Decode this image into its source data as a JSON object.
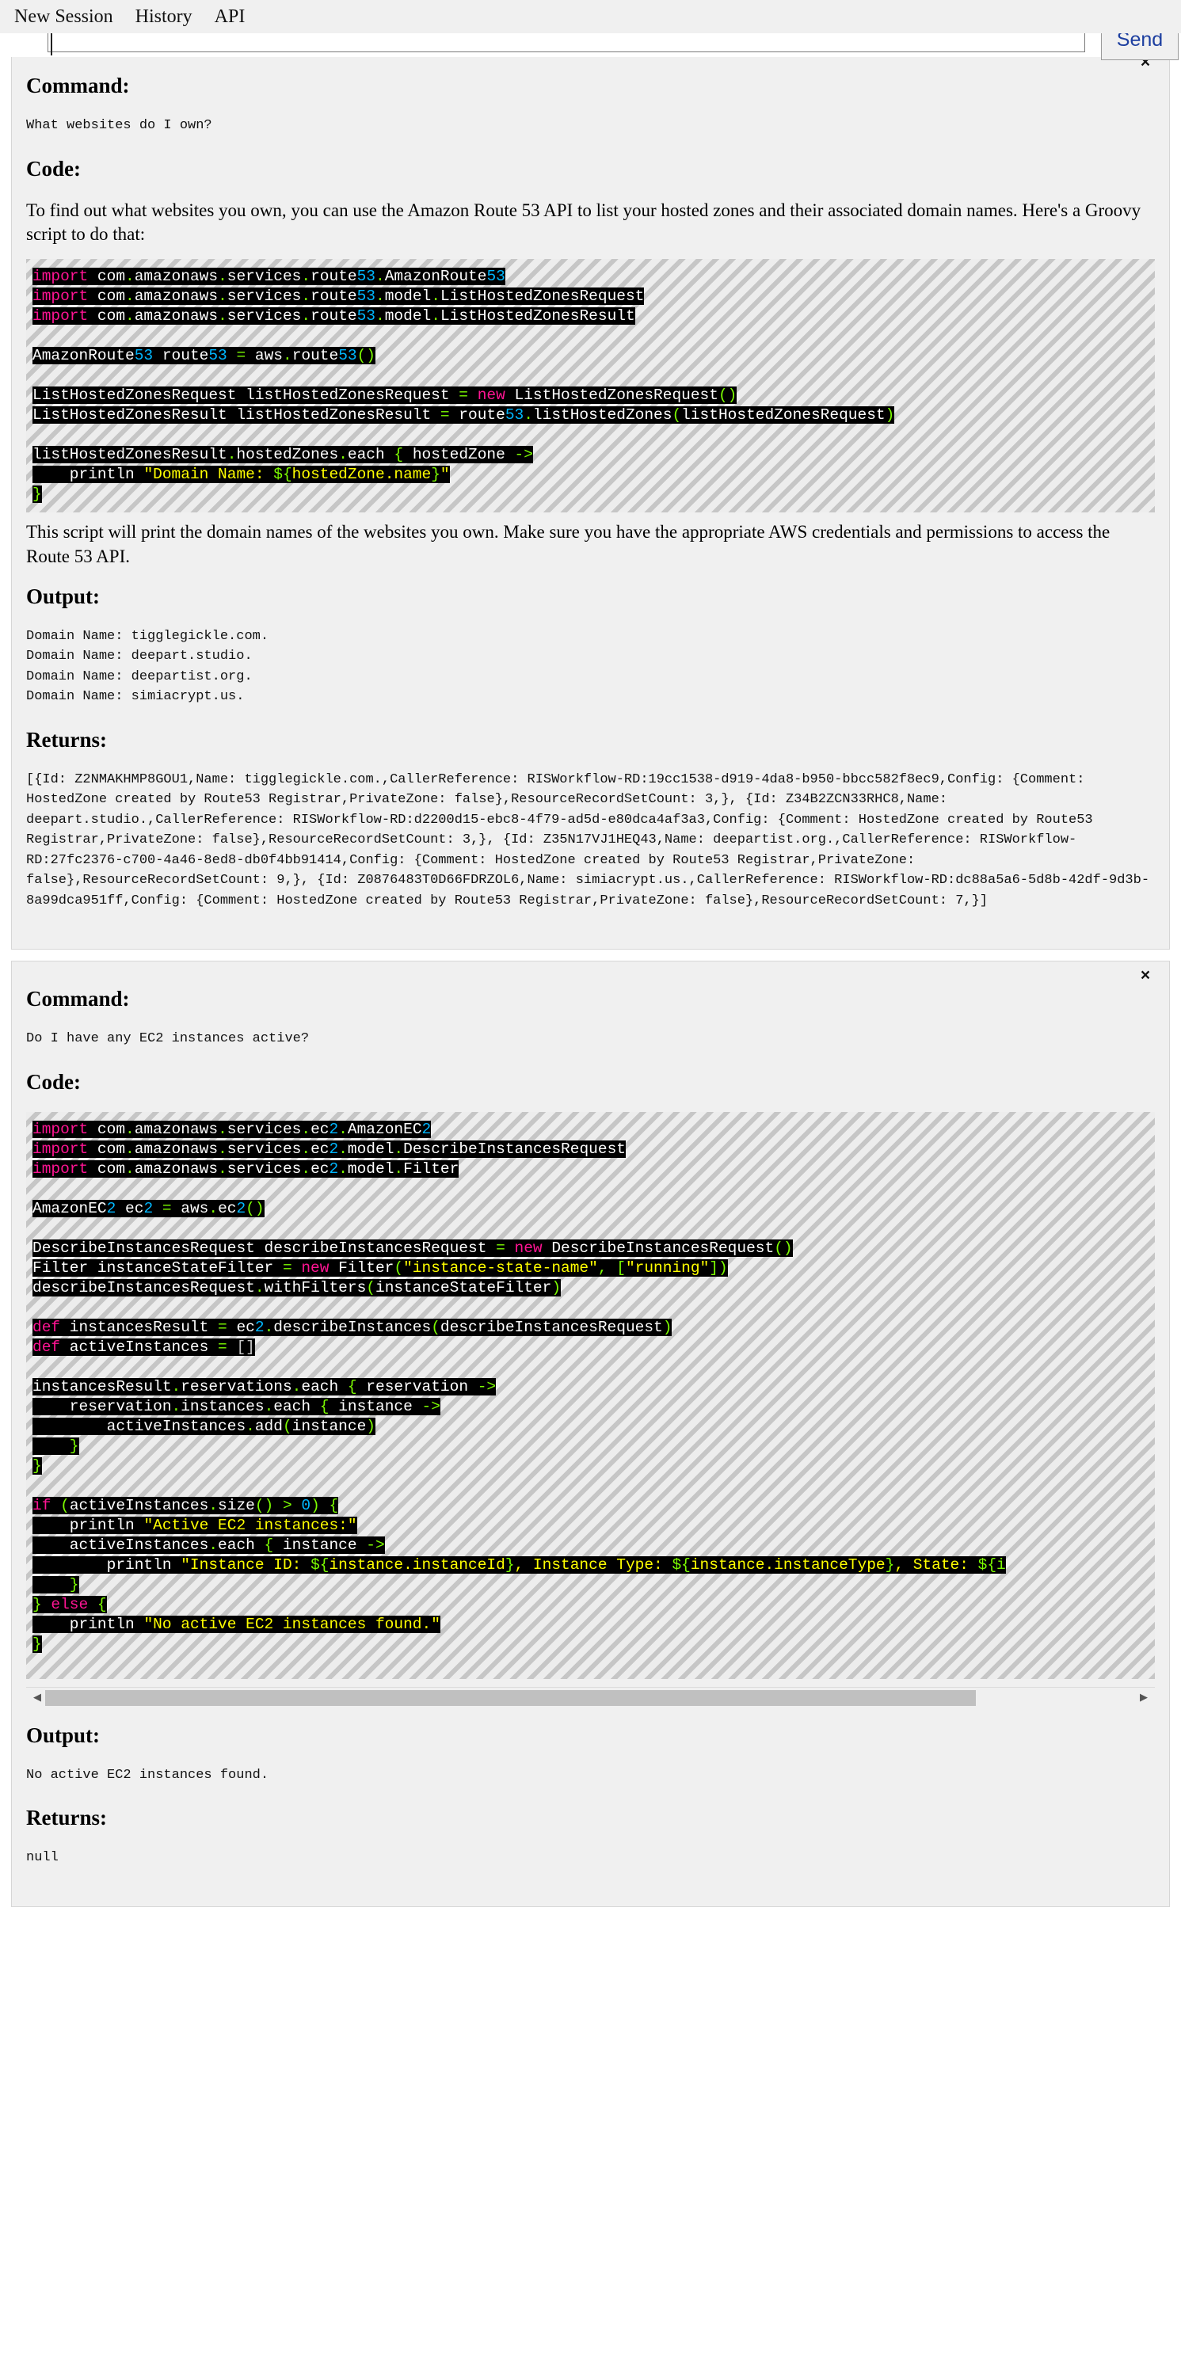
{
  "menubar": {
    "items": [
      {
        "label": "New Session",
        "name": "menu-new-session"
      },
      {
        "label": "History",
        "name": "menu-history"
      },
      {
        "label": "API",
        "name": "menu-api"
      }
    ]
  },
  "prompt": {
    "value": "",
    "placeholder": "",
    "send_label": "Send"
  },
  "labels": {
    "command": "Command:",
    "code": "Code:",
    "output": "Output:",
    "returns": "Returns:",
    "close": "×",
    "scroll_left": "◀",
    "scroll_right": "▶"
  },
  "cards": [
    {
      "id": "route53",
      "command": "What websites do I own?",
      "prose": "To find out what websites you own, you can use the Amazon Route 53 API to list your hosted zones and their associated domain names. Here's a Groovy script to do that:",
      "prose_after": "This script will print the domain names of the websites you own. Make sure you have the appropriate AWS credentials and permissions to access the Route 53 API.",
      "output": "Domain Name: tigglegickle.com.\nDomain Name: deepart.studio.\nDomain Name: deepartist.org.\nDomain Name: simiacrypt.us.",
      "returns": "[{Id: Z2NMAKHMP8GOU1,Name: tigglegickle.com.,CallerReference: RISWorkflow-RD:19cc1538-d919-4da8-b950-bbcc582f8ec9,Config: {Comment: HostedZone created by Route53 Registrar,PrivateZone: false},ResourceRecordSetCount: 3,}, {Id: Z34B2ZCN33RHC8,Name: deepart.studio.,CallerReference: RISWorkflow-RD:d2200d15-ebc8-4f79-ad5d-e80dca4af3a3,Config: {Comment: HostedZone created by Route53 Registrar,PrivateZone: false},ResourceRecordSetCount: 3,}, {Id: Z35N17VJ1HEQ43,Name: deepartist.org.,CallerReference: RISWorkflow-RD:27fc2376-c700-4a46-8ed8-db0f4bb91414,Config: {Comment: HostedZone created by Route53 Registrar,PrivateZone: false},ResourceRecordSetCount: 9,}, {Id: Z0876483T0D66FDRZOL6,Name: simiacrypt.us.,CallerReference: RISWorkflow-RD:dc88a5a6-5d8b-42df-9d3b-8a99dca951ff,Config: {Comment: HostedZone created by Route53 Registrar,PrivateZone: false},ResourceRecordSetCount: 7,}]",
      "has_scrollbar": false,
      "code_lines": [
        [
          {
            "t": "import",
            "c": "kw"
          },
          {
            "t": " com",
            "c": "var"
          },
          {
            "t": ".",
            "c": "dot"
          },
          {
            "t": "amazonaws",
            "c": "var"
          },
          {
            "t": ".",
            "c": "dot"
          },
          {
            "t": "services",
            "c": "var"
          },
          {
            "t": ".",
            "c": "dot"
          },
          {
            "t": "route",
            "c": "var"
          },
          {
            "t": "53",
            "c": "num"
          },
          {
            "t": ".",
            "c": "dot"
          },
          {
            "t": "AmazonRoute",
            "c": "var"
          },
          {
            "t": "53",
            "c": "num"
          }
        ],
        [
          {
            "t": "import",
            "c": "kw"
          },
          {
            "t": " com",
            "c": "var"
          },
          {
            "t": ".",
            "c": "dot"
          },
          {
            "t": "amazonaws",
            "c": "var"
          },
          {
            "t": ".",
            "c": "dot"
          },
          {
            "t": "services",
            "c": "var"
          },
          {
            "t": ".",
            "c": "dot"
          },
          {
            "t": "route",
            "c": "var"
          },
          {
            "t": "53",
            "c": "num"
          },
          {
            "t": ".",
            "c": "dot"
          },
          {
            "t": "model",
            "c": "var"
          },
          {
            "t": ".",
            "c": "dot"
          },
          {
            "t": "ListHostedZonesRequest",
            "c": "var"
          }
        ],
        [
          {
            "t": "import",
            "c": "kw"
          },
          {
            "t": " com",
            "c": "var"
          },
          {
            "t": ".",
            "c": "dot"
          },
          {
            "t": "amazonaws",
            "c": "var"
          },
          {
            "t": ".",
            "c": "dot"
          },
          {
            "t": "services",
            "c": "var"
          },
          {
            "t": ".",
            "c": "dot"
          },
          {
            "t": "route",
            "c": "var"
          },
          {
            "t": "53",
            "c": "num"
          },
          {
            "t": ".",
            "c": "dot"
          },
          {
            "t": "model",
            "c": "var"
          },
          {
            "t": ".",
            "c": "dot"
          },
          {
            "t": "ListHostedZonesResult",
            "c": "var"
          }
        ],
        [],
        [
          {
            "t": "AmazonRoute",
            "c": "var"
          },
          {
            "t": "53",
            "c": "num"
          },
          {
            "t": " route",
            "c": "var"
          },
          {
            "t": "53",
            "c": "num"
          },
          {
            "t": " ",
            "c": "var"
          },
          {
            "t": "=",
            "c": "dot"
          },
          {
            "t": " aws",
            "c": "var"
          },
          {
            "t": ".",
            "c": "dot"
          },
          {
            "t": "route",
            "c": "var"
          },
          {
            "t": "53",
            "c": "num"
          },
          {
            "t": "()",
            "c": "dot"
          }
        ],
        [],
        [
          {
            "t": "ListHostedZonesRequest listHostedZonesRequest ",
            "c": "var"
          },
          {
            "t": "=",
            "c": "dot"
          },
          {
            "t": " ",
            "c": "var"
          },
          {
            "t": "new",
            "c": "kw"
          },
          {
            "t": " ListHostedZonesRequest",
            "c": "var"
          },
          {
            "t": "()",
            "c": "dot"
          }
        ],
        [
          {
            "t": "ListHostedZonesResult listHostedZonesResult ",
            "c": "var"
          },
          {
            "t": "=",
            "c": "dot"
          },
          {
            "t": " route",
            "c": "var"
          },
          {
            "t": "53",
            "c": "num"
          },
          {
            "t": ".",
            "c": "dot"
          },
          {
            "t": "listHostedZones",
            "c": "var"
          },
          {
            "t": "(",
            "c": "dot"
          },
          {
            "t": "listHostedZonesRequest",
            "c": "var"
          },
          {
            "t": ")",
            "c": "dot"
          }
        ],
        [],
        [
          {
            "t": "listHostedZonesResult",
            "c": "var"
          },
          {
            "t": ".",
            "c": "dot"
          },
          {
            "t": "hostedZones",
            "c": "var"
          },
          {
            "t": ".",
            "c": "dot"
          },
          {
            "t": "each",
            "c": "var"
          },
          {
            "t": " { ",
            "c": "dot"
          },
          {
            "t": "hostedZone",
            "c": "var"
          },
          {
            "t": " ->",
            "c": "dot"
          }
        ],
        [
          {
            "t": "    println ",
            "c": "var"
          },
          {
            "t": "\"Domain Name: ",
            "c": "str"
          },
          {
            "t": "${",
            "c": "dot"
          },
          {
            "t": "hostedZone.name",
            "c": "str"
          },
          {
            "t": "}",
            "c": "dot"
          },
          {
            "t": "\"",
            "c": "str"
          }
        ],
        [
          {
            "t": "}",
            "c": "dot"
          }
        ]
      ]
    },
    {
      "id": "ec2",
      "command": "Do I have any EC2 instances active?",
      "prose": "",
      "prose_after": "",
      "output": "No active EC2 instances found.",
      "returns": "null",
      "has_scrollbar": true,
      "code_lines": [
        [
          {
            "t": "import",
            "c": "kw"
          },
          {
            "t": " com",
            "c": "var"
          },
          {
            "t": ".",
            "c": "dot"
          },
          {
            "t": "amazonaws",
            "c": "var"
          },
          {
            "t": ".",
            "c": "dot"
          },
          {
            "t": "services",
            "c": "var"
          },
          {
            "t": ".",
            "c": "dot"
          },
          {
            "t": "ec",
            "c": "var"
          },
          {
            "t": "2",
            "c": "num"
          },
          {
            "t": ".",
            "c": "dot"
          },
          {
            "t": "AmazonEC",
            "c": "var"
          },
          {
            "t": "2",
            "c": "num"
          }
        ],
        [
          {
            "t": "import",
            "c": "kw"
          },
          {
            "t": " com",
            "c": "var"
          },
          {
            "t": ".",
            "c": "dot"
          },
          {
            "t": "amazonaws",
            "c": "var"
          },
          {
            "t": ".",
            "c": "dot"
          },
          {
            "t": "services",
            "c": "var"
          },
          {
            "t": ".",
            "c": "dot"
          },
          {
            "t": "ec",
            "c": "var"
          },
          {
            "t": "2",
            "c": "num"
          },
          {
            "t": ".",
            "c": "dot"
          },
          {
            "t": "model",
            "c": "var"
          },
          {
            "t": ".",
            "c": "dot"
          },
          {
            "t": "DescribeInstancesRequest",
            "c": "var"
          }
        ],
        [
          {
            "t": "import",
            "c": "kw"
          },
          {
            "t": " com",
            "c": "var"
          },
          {
            "t": ".",
            "c": "dot"
          },
          {
            "t": "amazonaws",
            "c": "var"
          },
          {
            "t": ".",
            "c": "dot"
          },
          {
            "t": "services",
            "c": "var"
          },
          {
            "t": ".",
            "c": "dot"
          },
          {
            "t": "ec",
            "c": "var"
          },
          {
            "t": "2",
            "c": "num"
          },
          {
            "t": ".",
            "c": "dot"
          },
          {
            "t": "model",
            "c": "var"
          },
          {
            "t": ".",
            "c": "dot"
          },
          {
            "t": "Filter",
            "c": "var"
          }
        ],
        [],
        [
          {
            "t": "AmazonEC",
            "c": "var"
          },
          {
            "t": "2",
            "c": "num"
          },
          {
            "t": " ec",
            "c": "var"
          },
          {
            "t": "2",
            "c": "num"
          },
          {
            "t": " ",
            "c": "var"
          },
          {
            "t": "=",
            "c": "dot"
          },
          {
            "t": " aws",
            "c": "var"
          },
          {
            "t": ".",
            "c": "dot"
          },
          {
            "t": "ec",
            "c": "var"
          },
          {
            "t": "2",
            "c": "num"
          },
          {
            "t": "()",
            "c": "dot"
          }
        ],
        [],
        [
          {
            "t": "DescribeInstancesRequest describeInstancesRequest ",
            "c": "var"
          },
          {
            "t": "=",
            "c": "dot"
          },
          {
            "t": " ",
            "c": "var"
          },
          {
            "t": "new",
            "c": "kw"
          },
          {
            "t": " DescribeInstancesRequest",
            "c": "var"
          },
          {
            "t": "()",
            "c": "dot"
          }
        ],
        [
          {
            "t": "Filter instanceStateFilter ",
            "c": "var"
          },
          {
            "t": "=",
            "c": "dot"
          },
          {
            "t": " ",
            "c": "var"
          },
          {
            "t": "new",
            "c": "kw"
          },
          {
            "t": " Filter",
            "c": "var"
          },
          {
            "t": "(",
            "c": "dot"
          },
          {
            "t": "\"instance-state-name\"",
            "c": "str"
          },
          {
            "t": ", [",
            "c": "dot"
          },
          {
            "t": "\"running\"",
            "c": "str"
          },
          {
            "t": "])",
            "c": "dot"
          }
        ],
        [
          {
            "t": "describeInstancesRequest",
            "c": "var"
          },
          {
            "t": ".",
            "c": "dot"
          },
          {
            "t": "withFilters",
            "c": "var"
          },
          {
            "t": "(",
            "c": "dot"
          },
          {
            "t": "instanceStateFilter",
            "c": "var"
          },
          {
            "t": ")",
            "c": "dot"
          }
        ],
        [],
        [
          {
            "t": "def",
            "c": "kw"
          },
          {
            "t": " instancesResult ",
            "c": "var"
          },
          {
            "t": "=",
            "c": "dot"
          },
          {
            "t": " ec",
            "c": "var"
          },
          {
            "t": "2",
            "c": "num"
          },
          {
            "t": ".",
            "c": "dot"
          },
          {
            "t": "describeInstances",
            "c": "var"
          },
          {
            "t": "(",
            "c": "dot"
          },
          {
            "t": "describeInstancesRequest",
            "c": "var"
          },
          {
            "t": ")",
            "c": "dot"
          }
        ],
        [
          {
            "t": "def",
            "c": "kw"
          },
          {
            "t": " activeInstances ",
            "c": "var"
          },
          {
            "t": "=",
            "c": "dot"
          },
          {
            "t": " ",
            "c": "var"
          },
          {
            "t": "[]",
            "c": "dim"
          }
        ],
        [],
        [
          {
            "t": "instancesResult",
            "c": "var"
          },
          {
            "t": ".",
            "c": "dot"
          },
          {
            "t": "reservations",
            "c": "var"
          },
          {
            "t": ".",
            "c": "dot"
          },
          {
            "t": "each",
            "c": "var"
          },
          {
            "t": " { ",
            "c": "dot"
          },
          {
            "t": "reservation",
            "c": "var"
          },
          {
            "t": " ->",
            "c": "dot"
          }
        ],
        [
          {
            "t": "    reservation",
            "c": "var"
          },
          {
            "t": ".",
            "c": "dot"
          },
          {
            "t": "instances",
            "c": "var"
          },
          {
            "t": ".",
            "c": "dot"
          },
          {
            "t": "each",
            "c": "var"
          },
          {
            "t": " { ",
            "c": "dot"
          },
          {
            "t": "instance",
            "c": "var"
          },
          {
            "t": " ->",
            "c": "dot"
          }
        ],
        [
          {
            "t": "        activeInstances",
            "c": "var"
          },
          {
            "t": ".",
            "c": "dot"
          },
          {
            "t": "add",
            "c": "var"
          },
          {
            "t": "(",
            "c": "dot"
          },
          {
            "t": "instance",
            "c": "var"
          },
          {
            "t": ")",
            "c": "dot"
          }
        ],
        [
          {
            "t": "    }",
            "c": "dot"
          }
        ],
        [
          {
            "t": "}",
            "c": "dot"
          }
        ],
        [],
        [
          {
            "t": "if",
            "c": "kw"
          },
          {
            "t": " (",
            "c": "dot"
          },
          {
            "t": "activeInstances",
            "c": "var"
          },
          {
            "t": ".",
            "c": "dot"
          },
          {
            "t": "size",
            "c": "var"
          },
          {
            "t": "() ",
            "c": "dot"
          },
          {
            "t": ">",
            "c": "dot"
          },
          {
            "t": " ",
            "c": "var"
          },
          {
            "t": "0",
            "c": "num"
          },
          {
            "t": ") {",
            "c": "dot"
          }
        ],
        [
          {
            "t": "    println ",
            "c": "var"
          },
          {
            "t": "\"Active EC2 instances:\"",
            "c": "str"
          }
        ],
        [
          {
            "t": "    activeInstances",
            "c": "var"
          },
          {
            "t": ".",
            "c": "dot"
          },
          {
            "t": "each",
            "c": "var"
          },
          {
            "t": " { ",
            "c": "dot"
          },
          {
            "t": "instance",
            "c": "var"
          },
          {
            "t": " ->",
            "c": "dot"
          }
        ],
        [
          {
            "t": "        println ",
            "c": "var"
          },
          {
            "t": "\"Instance ID: ",
            "c": "str"
          },
          {
            "t": "${",
            "c": "dot"
          },
          {
            "t": "instance.instanceId",
            "c": "str"
          },
          {
            "t": "}",
            "c": "dot"
          },
          {
            "t": ", Instance Type: ",
            "c": "str"
          },
          {
            "t": "${",
            "c": "dot"
          },
          {
            "t": "instance.instanceType",
            "c": "str"
          },
          {
            "t": "}",
            "c": "dot"
          },
          {
            "t": ", State: ",
            "c": "str"
          },
          {
            "t": "${i",
            "c": "dot"
          }
        ],
        [
          {
            "t": "    }",
            "c": "dot"
          }
        ],
        [
          {
            "t": "} ",
            "c": "dot"
          },
          {
            "t": "else",
            "c": "kw"
          },
          {
            "t": " {",
            "c": "dot"
          }
        ],
        [
          {
            "t": "    println ",
            "c": "var"
          },
          {
            "t": "\"No active EC2 instances found.\"",
            "c": "str"
          }
        ],
        [
          {
            "t": "}",
            "c": "dot"
          }
        ],
        []
      ]
    }
  ]
}
